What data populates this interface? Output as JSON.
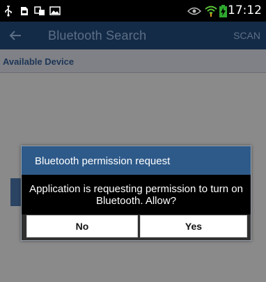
{
  "status_bar": {
    "time": "17:12",
    "icons": [
      "usb-icon",
      "sim-card-icon",
      "sync-icon",
      "image-icon",
      "eye-icon",
      "wifi-icon",
      "battery-charging-icon"
    ]
  },
  "toolbar": {
    "title": "Bluetooth Search",
    "scan_label": "SCAN",
    "back_icon": "back-arrow-icon"
  },
  "main": {
    "section_header": "Available Device"
  },
  "dialog": {
    "title": "Bluetooth permission request",
    "message": "Application is requesting permission to turn on Bluetooth. Allow?",
    "no_label": "No",
    "yes_label": "Yes"
  },
  "colors": {
    "toolbar_bg": "#142b47",
    "dialog_header_bg": "#2e5a8a",
    "battery_green": "#2fa82f",
    "wifi_green": "#5cc63a"
  }
}
